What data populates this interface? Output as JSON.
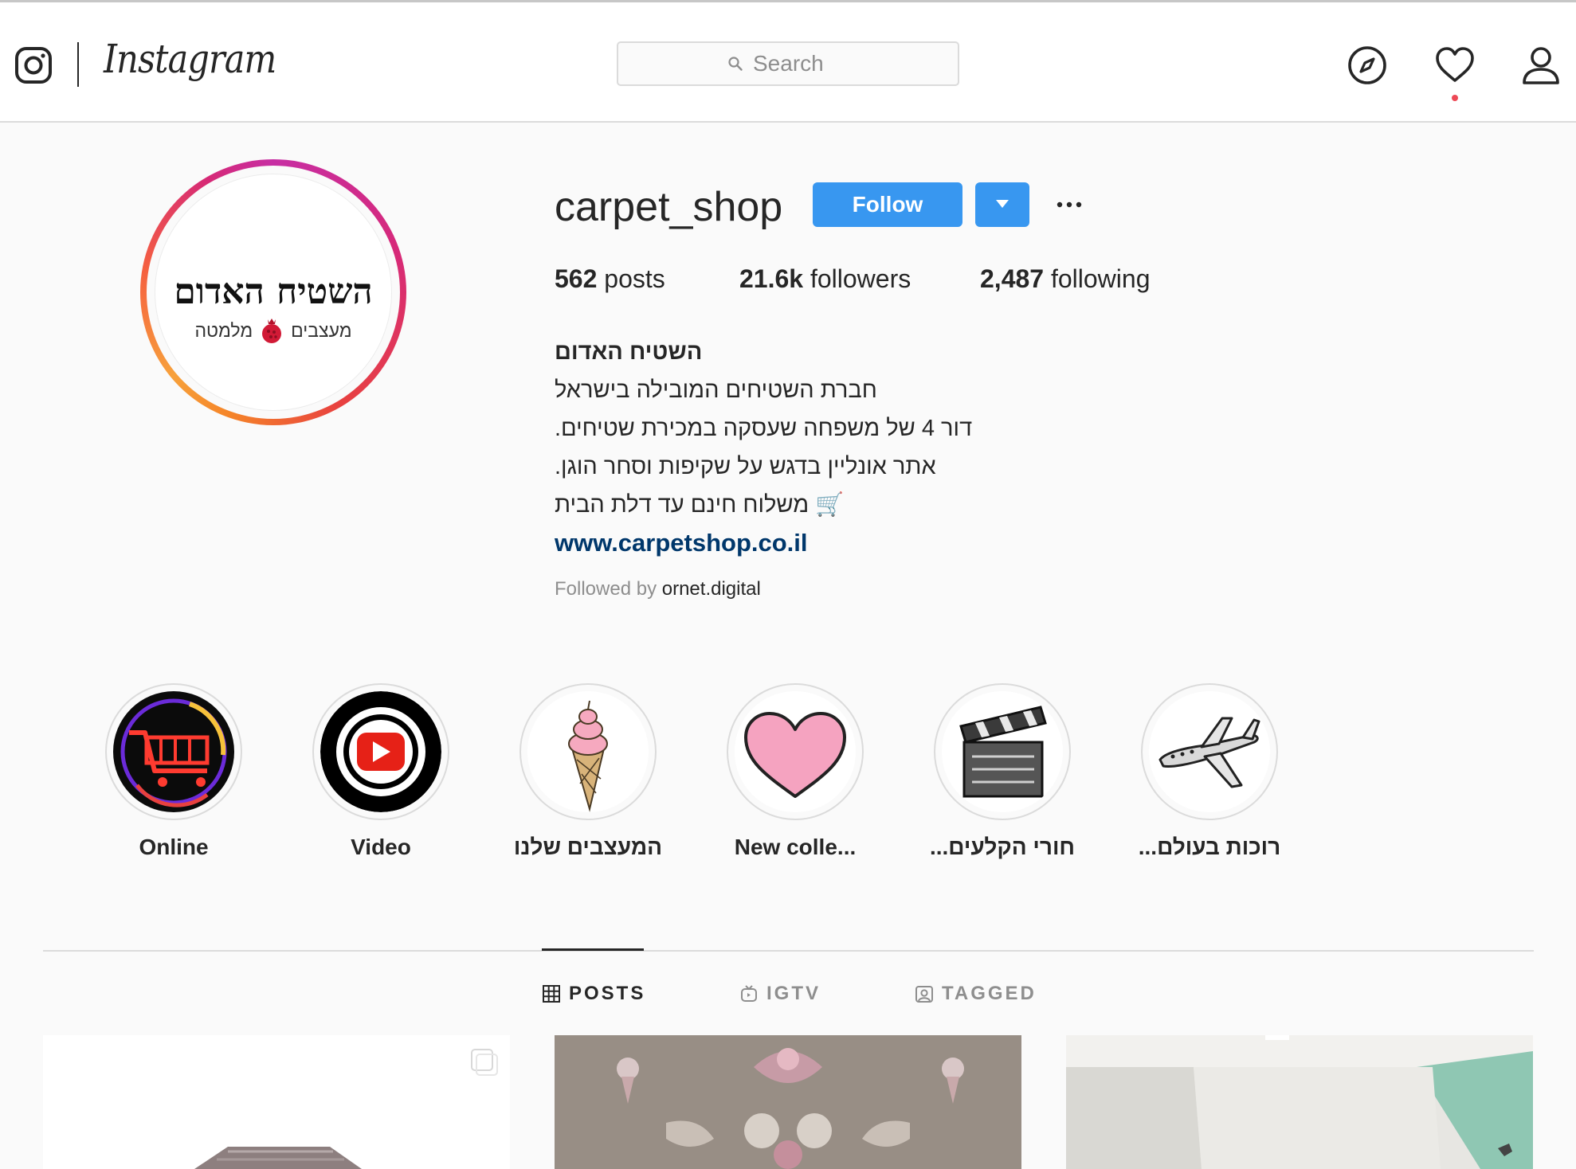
{
  "nav": {
    "logo_text": "Instagram",
    "search_placeholder": "Search",
    "icons": [
      "instagram-glyph-icon",
      "search-icon",
      "compass-icon",
      "heart-icon",
      "profile-icon"
    ],
    "notification_dot_color": "#ed4956"
  },
  "profile": {
    "username": "carpet_shop",
    "avatar_logo": {
      "main": "השטיח האדום",
      "left": "מעצבים",
      "right": "מלמטה"
    },
    "follow_label": "Follow",
    "button_color": "#3897f0",
    "stats": {
      "posts_count": "562",
      "posts_label": "posts",
      "followers_count": "21.6k",
      "followers_label": "followers",
      "following_count": "2,487",
      "following_label": "following"
    },
    "bio": {
      "name": "השטיח האדום",
      "line1": "חברת השטיחים המובילה בישראל",
      "line2": "דור 4 של משפחה שעסקה במכירת שטיחים.",
      "line3": "אתר אונליין בדגש על שקיפות וסחר הוגן.",
      "line4": "🛒 משלוח חינם עד דלת הבית",
      "link": "www.carpetshop.co.il"
    },
    "followed_by_prefix": "Followed by",
    "followed_by_user": "ornet.digital"
  },
  "highlights": [
    {
      "label": "Online"
    },
    {
      "label": "Video"
    },
    {
      "label": "המעצבים שלנו"
    },
    {
      "label": "New colle..."
    },
    {
      "label": "חורי הקלעים..."
    },
    {
      "label": "רוכות בעולם..."
    }
  ],
  "tabs": [
    {
      "label": "POSTS",
      "active": true
    },
    {
      "label": "IGTV",
      "active": false
    },
    {
      "label": "TAGGED",
      "active": false
    }
  ]
}
